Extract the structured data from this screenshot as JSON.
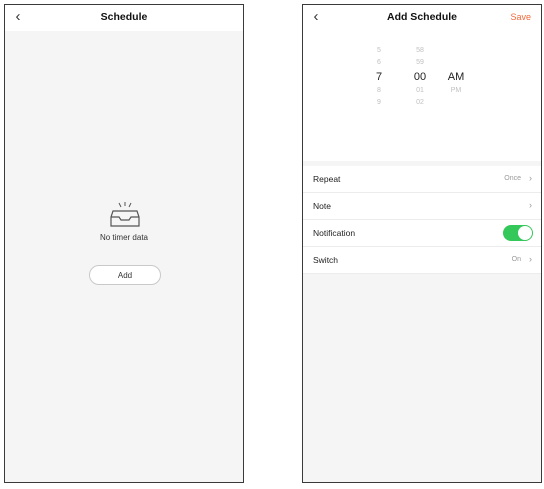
{
  "schedule_screen": {
    "back_glyph": "‹",
    "title": "Schedule",
    "empty_text": "No timer data",
    "add_label": "Add",
    "icons": {
      "back": "chevron-left-icon",
      "empty": "empty-inbox-icon"
    }
  },
  "add_schedule_screen": {
    "back_glyph": "‹",
    "title": "Add Schedule",
    "save_label": "Save",
    "picker": {
      "hours": [
        "5",
        "6",
        "7",
        "8",
        "9"
      ],
      "minutes": [
        "58",
        "59",
        "00",
        "01",
        "02"
      ],
      "ampm": [
        "",
        "",
        "AM",
        "PM",
        ""
      ],
      "selected_index": 2
    },
    "settings": [
      {
        "label": "Repeat",
        "value": "Once",
        "type": "nav"
      },
      {
        "label": "Note",
        "value": "",
        "type": "nav"
      },
      {
        "label": "Notification",
        "value": "",
        "type": "toggle",
        "on": true
      },
      {
        "label": "Switch",
        "value": "On",
        "type": "nav"
      }
    ],
    "chevron_glyph": "›",
    "colors": {
      "accent": "#f2693a",
      "toggle_on": "#34c759"
    }
  }
}
